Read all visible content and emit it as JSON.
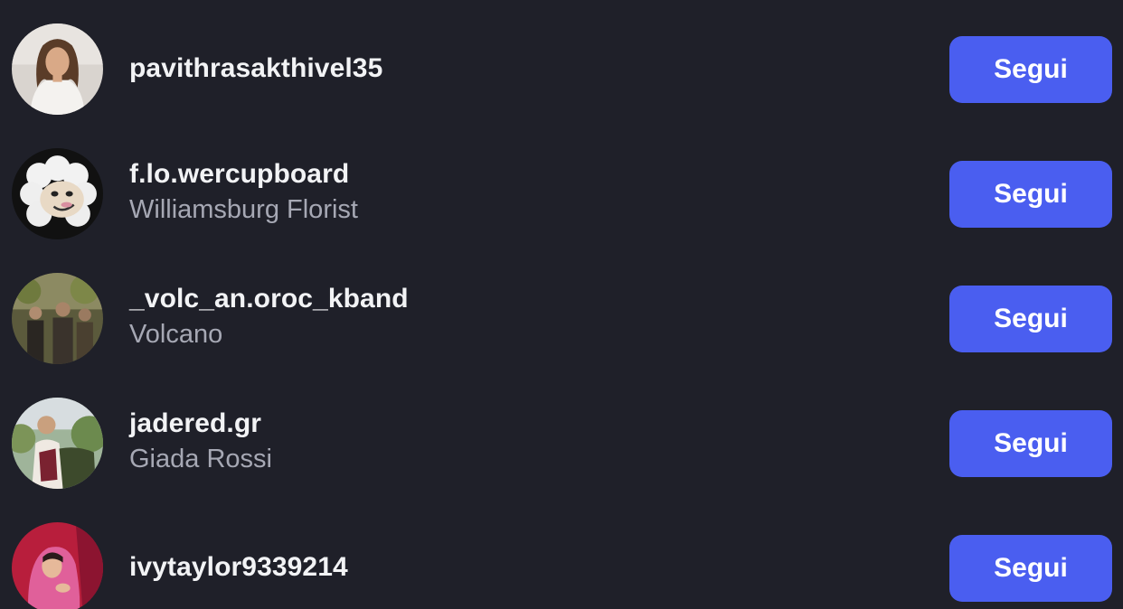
{
  "suggestions": [
    {
      "username": "pavithrasakthivel35",
      "full_name": "",
      "avatar_icon": "woman-portrait-avatar",
      "follow_label": "Segui"
    },
    {
      "username": "f.lo.wercupboard",
      "full_name": "Williamsburg Florist",
      "avatar_icon": "cartoon-sheep-avatar",
      "follow_label": "Segui"
    },
    {
      "username": "_volc_an.oroc_kband",
      "full_name": "Volcano",
      "avatar_icon": "band-group-avatar",
      "follow_label": "Segui"
    },
    {
      "username": "jadered.gr",
      "full_name": "Giada Rossi",
      "avatar_icon": "person-outdoors-avatar",
      "follow_label": "Segui"
    },
    {
      "username": "ivytaylor9339214",
      "full_name": "",
      "avatar_icon": "person-red-background-avatar",
      "follow_label": "Segui"
    }
  ],
  "colors": {
    "background": "#1f2029",
    "button": "#4a5ef0",
    "username_text": "#f2f3f5",
    "secondary_text": "#a6a8b4"
  }
}
